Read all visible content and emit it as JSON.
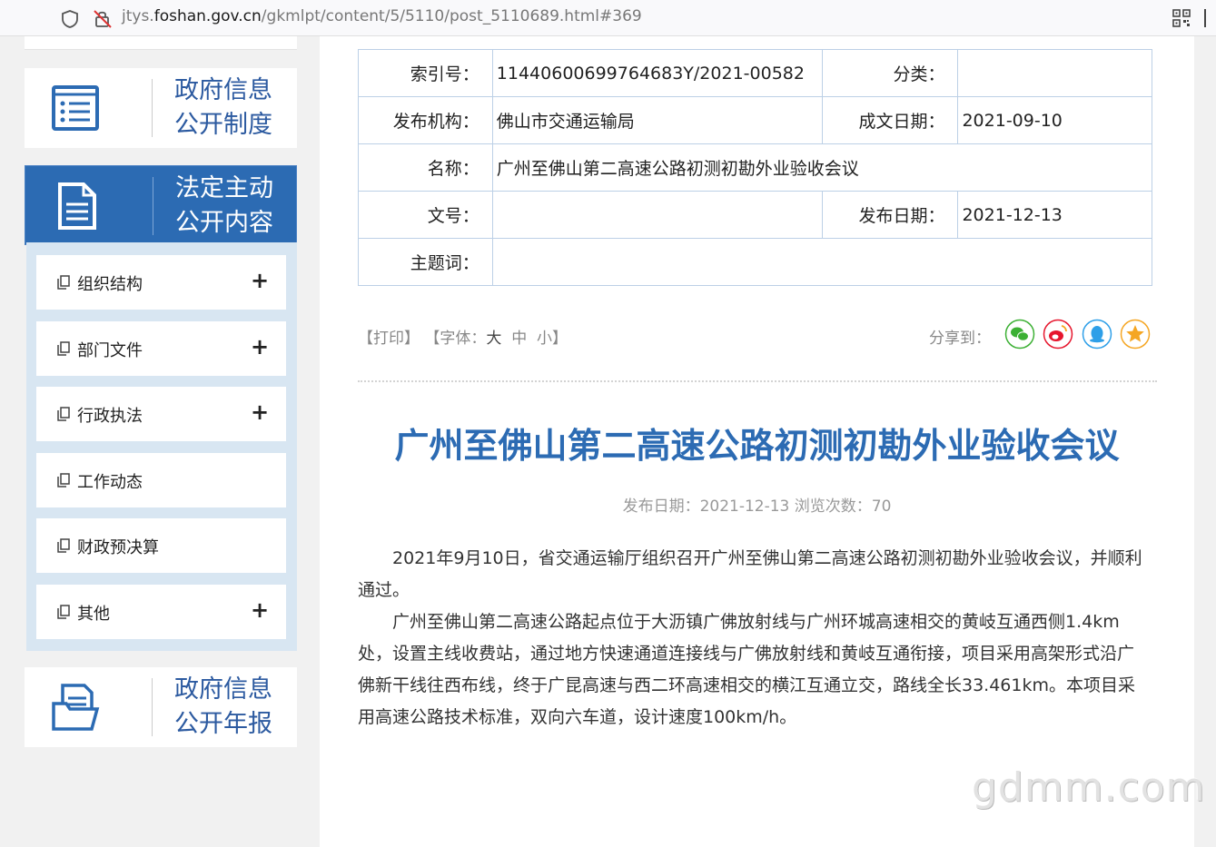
{
  "browser": {
    "url_prefix": "jtys.",
    "url_domain": "foshan.gov.cn",
    "url_path": "/gkmlpt/content/5/5110/post_5110689.html#369"
  },
  "sidebar": {
    "system_box": {
      "line1": "政府信息",
      "line2": "公开制度",
      "icon": "list-document-icon"
    },
    "active_box": {
      "line1": "法定主动",
      "line2": "公开内容",
      "icon": "document-icon"
    },
    "items": [
      {
        "label": "组织结构",
        "expand": "+"
      },
      {
        "label": "部门文件",
        "expand": "+"
      },
      {
        "label": "行政执法",
        "expand": "+"
      },
      {
        "label": "工作动态",
        "expand": ""
      },
      {
        "label": "财政预决算",
        "expand": ""
      },
      {
        "label": "其他",
        "expand": "+"
      }
    ],
    "annual_box": {
      "line1": "政府信息",
      "line2": "公开年报",
      "icon": "folder-document-icon"
    }
  },
  "meta": {
    "index_label": "索引号：",
    "index_value": "11440600699764683Y/2021-00582",
    "category_label": "分类：",
    "category_value": "",
    "publisher_label": "发布机构：",
    "publisher_value": "佛山市交通运输局",
    "created_label": "成文日期：",
    "created_value": "2021-09-10",
    "name_label": "名称：",
    "name_value": "广州至佛山第二高速公路初测初勘外业验收会议",
    "docno_label": "文号：",
    "docno_value": "",
    "pubdate_label": "发布日期：",
    "pubdate_value": "2021-12-13",
    "keywords_label": "主题词：",
    "keywords_value": ""
  },
  "toolbar": {
    "print": "【打印】",
    "font_open": "【字体：",
    "font_large": "大",
    "font_medium": "中",
    "font_small": "小",
    "font_close": "】",
    "share_label": "分享到："
  },
  "share_colors": {
    "wechat": "#3cb034",
    "weibo": "#e6162d",
    "qq": "#2e9fe8",
    "favorite": "#f5a623"
  },
  "article": {
    "title": "广州至佛山第二高速公路初测初勘外业验收会议",
    "meta_line": "发布日期：2021-12-13  浏览次数：70",
    "paragraphs": [
      "2021年9月10日，省交通运输厅组织召开广州至佛山第二高速公路初测初勘外业验收会议，并顺利通过。",
      "广州至佛山第二高速公路起点位于大沥镇广佛放射线与广州环城高速相交的黄岐互通西侧1.4km 处，设置主线收费站，通过地方快速通道连接线与广佛放射线和黄岐互通衔接，项目采用高架形式沿广佛新干线往西布线，终于广昆高速与西二环高速相交的横江互通立交，路线全长33.461km。本项目采用高速公路技术标准，双向六车道，设计速度100km/h。"
    ]
  },
  "watermark": "gdmm.com"
}
